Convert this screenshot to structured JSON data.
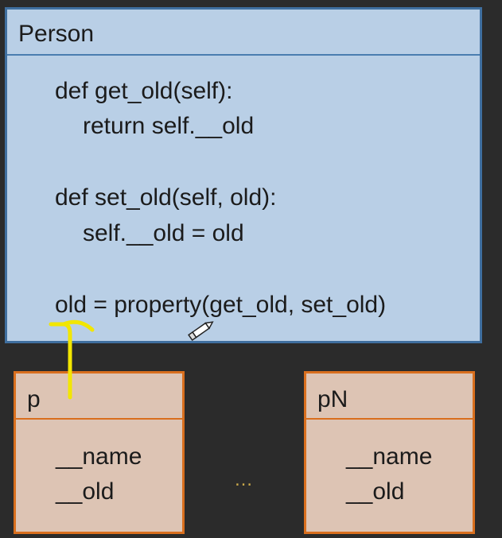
{
  "class_box": {
    "name": "Person",
    "code_lines": [
      "def get_old(self):",
      "return self.__old",
      "def set_old(self, old):",
      "self.__old = old",
      "old = property(get_old, set_old)"
    ]
  },
  "instances": [
    {
      "name": "p",
      "attrs": [
        "__name",
        "__old"
      ]
    },
    {
      "name": "pN",
      "attrs": [
        "__name",
        "__old"
      ]
    }
  ],
  "ellipsis": "…",
  "colors": {
    "class_fill": "#b9cfe6",
    "class_border": "#3f6f9f",
    "instance_fill": "#ddc4b4",
    "instance_border": "#d96f1e",
    "annotation_arrow": "#f2e600",
    "background": "#2b2b2b"
  },
  "icons": {
    "cursor": "pen-cursor-icon"
  }
}
